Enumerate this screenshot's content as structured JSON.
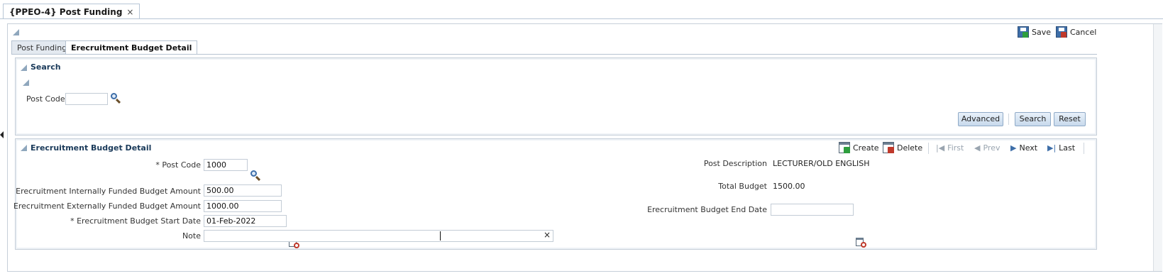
{
  "document_tab": {
    "title": "{PPEO-4} Post Funding",
    "close": "×"
  },
  "toolbar": {
    "save_label": "Save",
    "cancel_label": "Cancel"
  },
  "tabs": [
    {
      "label": "Post Funding",
      "active": false
    },
    {
      "label": "Erecruitment Budget Detail",
      "active": true
    }
  ],
  "search": {
    "header": "Search",
    "post_code_label": "Post Code",
    "post_code_value": "",
    "advanced_label": "Advanced",
    "search_label": "Search",
    "reset_label": "Reset"
  },
  "detail": {
    "header": "Erecruitment Budget Detail",
    "actions": {
      "create": "Create",
      "delete": "Delete",
      "first": "First",
      "prev": "Prev",
      "next": "Next",
      "last": "Last"
    },
    "fields": {
      "post_code_label": "* Post Code",
      "post_code_value": "1000",
      "internal_label": "Erecruitment Internally Funded Budget Amount",
      "internal_value": "500.00",
      "external_label": "Erecruitment Externally Funded Budget Amount",
      "external_value": "1000.00",
      "start_label": "* Erecruitment Budget Start Date",
      "start_value": "01-Feb-2022",
      "note_label": "Note",
      "note_value": "",
      "note_clear": "×",
      "post_desc_label": "Post Description",
      "post_desc_value": "LECTURER/OLD ENGLISH",
      "total_label": "Total Budget",
      "total_value": "1500.00",
      "end_label": "Erecruitment Budget End Date",
      "end_value": ""
    }
  },
  "colors": {
    "header_text": "#1a3a5a",
    "link_blue": "#3e6ea8",
    "button_border": "#8faac7"
  }
}
